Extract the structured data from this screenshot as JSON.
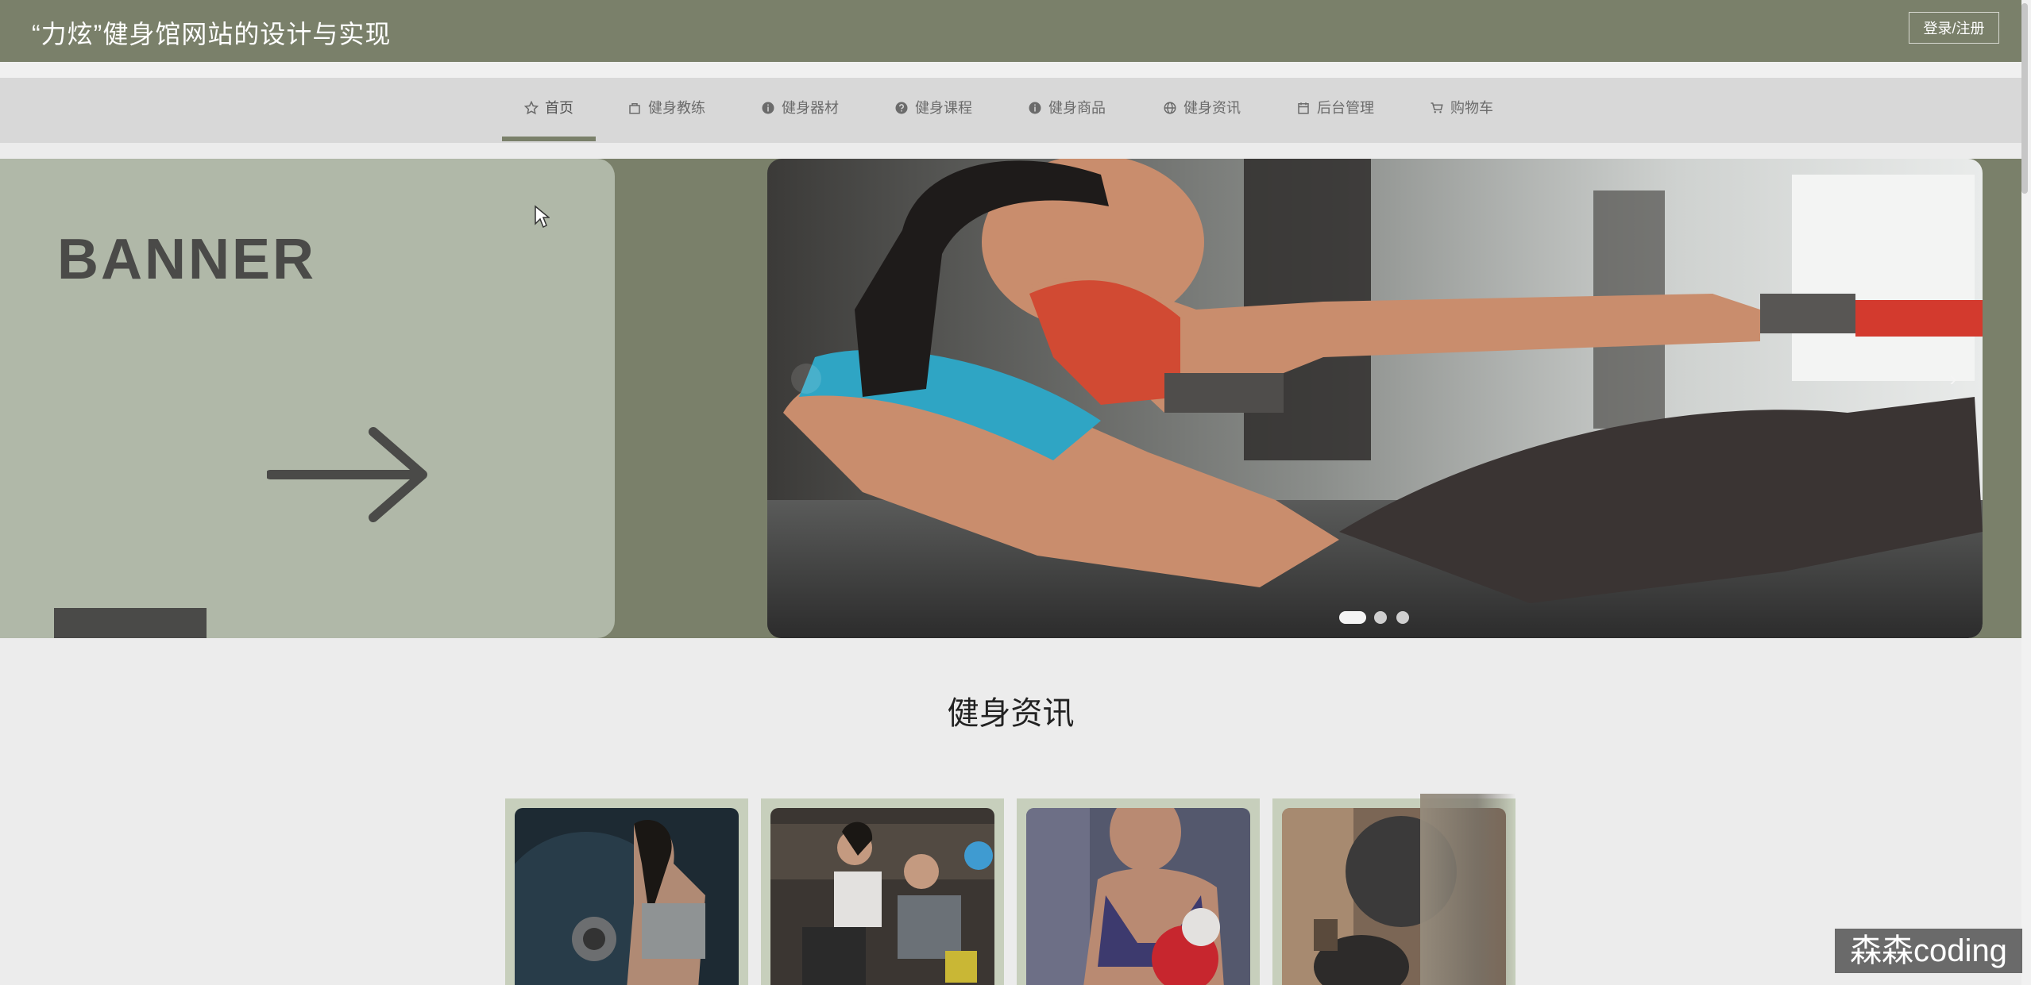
{
  "header": {
    "title": "“力炫”健身馆网站的设计与实现",
    "login_label": "登录/注册"
  },
  "nav": {
    "items": [
      {
        "label": "首页",
        "icon": "star-icon",
        "active": true
      },
      {
        "label": "健身教练",
        "icon": "bag-icon"
      },
      {
        "label": "健身器材",
        "icon": "info-circle-icon"
      },
      {
        "label": "健身课程",
        "icon": "question-circle-icon"
      },
      {
        "label": "健身商品",
        "icon": "info-circle-icon"
      },
      {
        "label": "健身资讯",
        "icon": "globe-icon"
      },
      {
        "label": "后台管理",
        "icon": "calendar-icon"
      },
      {
        "label": "购物车",
        "icon": "cart-icon"
      }
    ]
  },
  "banner": {
    "word": "BANNER",
    "arrow_icon": "arrow-right-icon",
    "slide_image": "woman-boxing-situp-photo",
    "next_icon": "chevron-right-icon",
    "dots_count": 3,
    "active_dot": 1
  },
  "news": {
    "title": "健身资讯",
    "cards": [
      {
        "image": "woman-dumbbell-photo"
      },
      {
        "image": "trainer-couple-gym-photo"
      },
      {
        "image": "woman-boxing-gloves-photo"
      },
      {
        "image": "gym-workout-photo"
      }
    ]
  },
  "watermark": "森森coding",
  "colors": {
    "header_bg": "#7a806a",
    "nav_bg": "#d8d8d8",
    "banner_card": "#b0b8a8",
    "card_frame": "#c7cfbc"
  }
}
